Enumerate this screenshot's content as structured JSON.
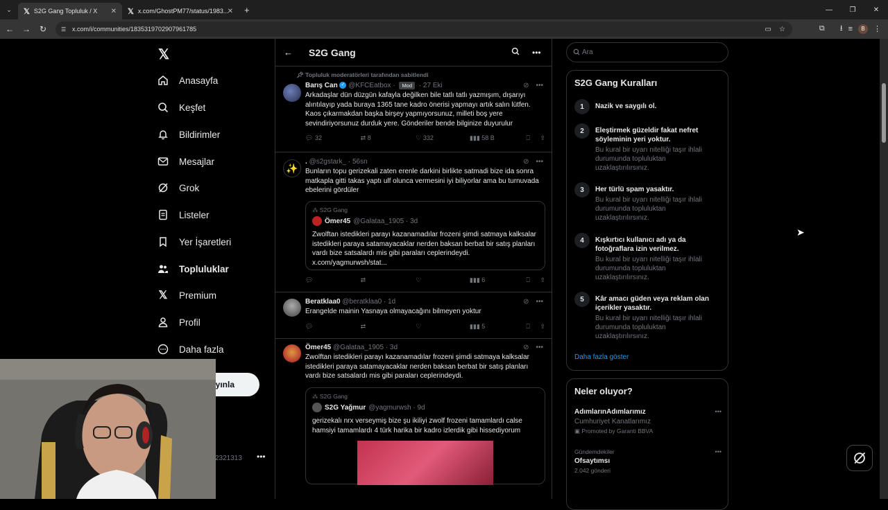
{
  "browser": {
    "tabs": [
      {
        "title": "S2G Gang Topluluk / X"
      },
      {
        "title": "x.com/GhostPM77/status/1983..."
      }
    ],
    "url": "x.com/i/communities/1835319702907961785",
    "profile_initial": "B"
  },
  "leftnav": {
    "items": [
      {
        "label": "Anasayfa"
      },
      {
        "label": "Keşfet"
      },
      {
        "label": "Bildirimler"
      },
      {
        "label": "Mesajlar"
      },
      {
        "label": "Grok"
      },
      {
        "label": "Listeler"
      },
      {
        "label": "Yer İşaretleri"
      },
      {
        "label": "Topluluklar"
      },
      {
        "label": "Premium"
      },
      {
        "label": "Profil"
      },
      {
        "label": "Daha fazla"
      }
    ],
    "post_button_fragment": "ayınla",
    "user_handle_fragment": "2321313"
  },
  "main": {
    "header_title": "S2G Gang",
    "pinned_label": "Topluluk moderatörleri tarafından sabitlendi",
    "tweets": [
      {
        "name": "Barış Can",
        "handle": "@KFCEatbox",
        "badge": "Mod",
        "time": "27 Eki",
        "text": "Arkadaşlar dün düzgün kafayla değilken bile tatlı tatlı yazmışım, dışarıyı alıntılayıp yada buraya 1365 tane kadro önerisi yapmayı artık salın lütfen. Kaos çıkarmakdan başka birşey yapmıyorsunuz, milleti boş yere sevindiriyorsunuz durduk yere. Gönderiler bende bilginize duyurulur",
        "replies": "32",
        "reposts": "8",
        "likes": "332",
        "views": "58 B"
      },
      {
        "name": ".",
        "handle": "@s2gstark_",
        "time": "56sn",
        "text": "Bunların topu gerizekali zaten erenle darkini birlikte satmadi bize ida sonra matkapla gitti takas yaptı ulf olunca vermesini iyi biliyorlar ama bu turnuvada ebelerini gördüler",
        "views": "6",
        "quote": {
          "community": "S2G Gang",
          "name": "Ömer45",
          "handle": "@Galataa_1905",
          "time": "3d",
          "text": "Zwolftan istedikleri parayı kazanamadılar frozeni şimdi satmaya kalksalar istedikleri paraya satamayacaklar nerden baksan berbat bir satış planları vardı bize satsalardı mis gibi paraları ceplerindeydi. x.com/yagmurwsh/stat..."
        }
      },
      {
        "name": "Beratklaa0",
        "handle": "@beratklaa0",
        "time": "1d",
        "text": "Erangelde mainin Yasnaya olmayacağını bilmeyen yoktur",
        "views": "5"
      },
      {
        "name": "Ömer45",
        "handle": "@Galataa_1905",
        "time": "3d",
        "text": "Zwolftan istedikleri parayı kazanamadılar frozeni şimdi satmaya kalksalar istedikleri paraya satamayacaklar nerden baksan berbat bir satış planları vardı bize satsalardı mis gibi paraları ceplerindeydi.",
        "quote": {
          "community": "S2G Gang",
          "name": "S2G Yağmur",
          "handle": "@yagmurwsh",
          "time": "9d",
          "text": "gerizekalı nrx verseymiş bize şu ikiliyi zwolf frozeni tamamlardı calse hamsiyi tamamlardı 4 türk harika bir kadro izlerdik gibi hissediyorum"
        }
      }
    ]
  },
  "sidebar": {
    "search_placeholder": "Ara",
    "rules_title": "S2G Gang Kuralları",
    "rules": [
      {
        "num": "1",
        "title": "Nazik ve saygılı ol.",
        "desc": ""
      },
      {
        "num": "2",
        "title": "Eleştirmek güzeldir fakat nefret söyleminin yeri yoktur.",
        "desc": "Bu kural bir uyarı nitelliği taşır ihlali durumunda topluluktan uzaklaştırılırsınız."
      },
      {
        "num": "3",
        "title": "Her türlü spam yasaktır.",
        "desc": "Bu kural bir uyarı nitelliği taşır ihlali durumunda topluluktan uzaklaştırılırsınız."
      },
      {
        "num": "4",
        "title": "Kışkırtıcı kullanıcı adı ya da fotoğraflara izin verilmez.",
        "desc": "Bu kural bir uyarı nitelliği taşır ihlali durumunda topluluktan uzaklaştırılırsınız."
      },
      {
        "num": "5",
        "title": "Kâr amacı güden veya reklam olan içerikler yasaktır.",
        "desc": "Bu kural bir uyarı nitelliği taşır ihlali durumunda topluluktan uzaklaştırılırsınız."
      }
    ],
    "more_link": "Daha fazla göster",
    "trends_title": "Neler oluyor?",
    "trends": [
      {
        "name": "AdımlarınAdımlarımız",
        "sub": "Cumhuriyet Kanatlarımız",
        "meta": "Promoted by Garanti BBVA"
      },
      {
        "name": "Ofsaytımsı",
        "sub": "2.042 gönderi",
        "meta": "Gündemdekiler"
      }
    ]
  },
  "colors": {
    "accent": "#1d9bf0",
    "bg": "#000000",
    "border": "#2f3336",
    "muted": "#71767b"
  }
}
